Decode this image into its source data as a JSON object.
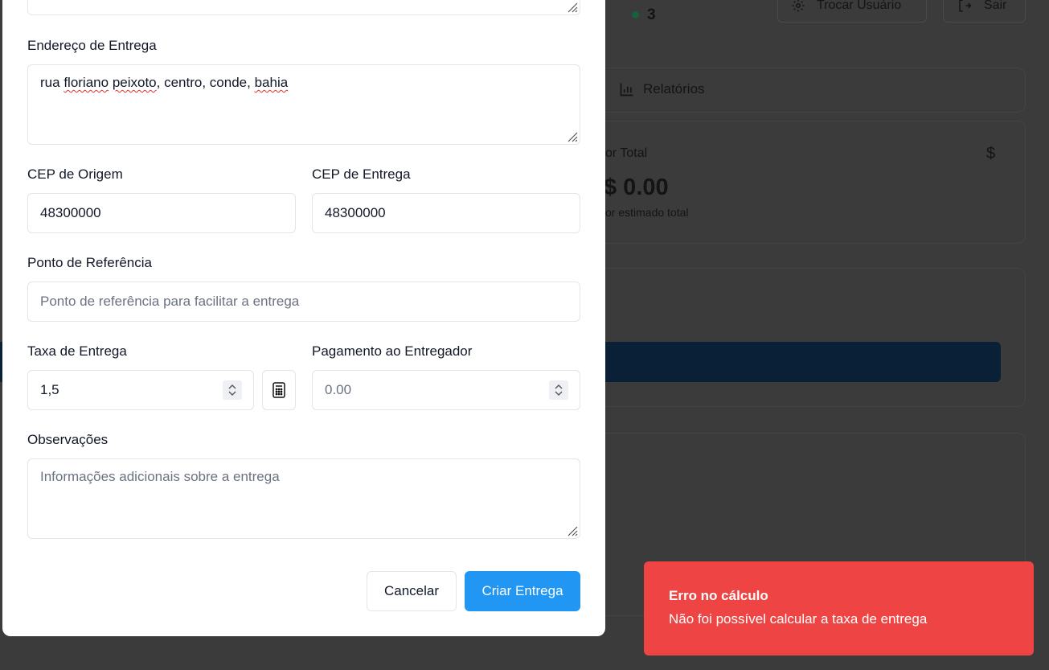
{
  "background": {
    "counter_value": "3",
    "switch_user_label": "Trocar Usuário",
    "logout_label": "Sair",
    "reports_tab_label": "Relatórios",
    "total_card": {
      "title": "or Total",
      "value": "$ 0.00",
      "subtitle": "or estimado total"
    }
  },
  "modal": {
    "delivery_address": {
      "label": "Endereço de Entrega",
      "value": "rua floriano peixoto, centro, conde, bahia",
      "words": [
        "rua",
        "floriano",
        "peixoto",
        "centro",
        "conde",
        "bahia"
      ]
    },
    "origin_cep": {
      "label": "CEP de Origem",
      "value": "48300000"
    },
    "delivery_cep": {
      "label": "CEP de Entrega",
      "value": "48300000"
    },
    "reference_point": {
      "label": "Ponto de Referência",
      "placeholder": "Ponto de referência para facilitar a entrega"
    },
    "delivery_fee": {
      "label": "Taxa de Entrega",
      "value": "1,5"
    },
    "courier_payment": {
      "label": "Pagamento ao Entregador",
      "placeholder": "0.00"
    },
    "notes": {
      "label": "Observações",
      "placeholder": "Informações adicionais sobre a entrega"
    },
    "cancel_label": "Cancelar",
    "submit_label": "Criar Entrega"
  },
  "toast": {
    "title": "Erro no cálculo",
    "description": "Não foi possível calcular a taxa de entrega"
  },
  "colors": {
    "primary": "#2196f3",
    "toast_error": "#ef4444",
    "online_dot": "#16a34a",
    "overlay": "#3b3b3b"
  }
}
